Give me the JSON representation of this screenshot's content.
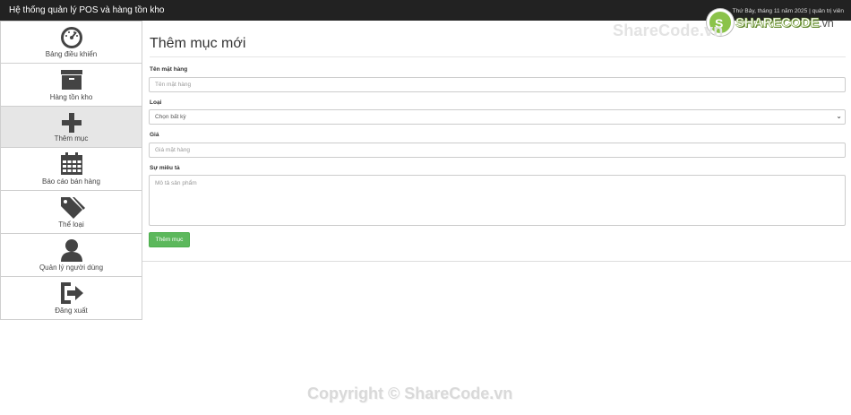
{
  "header": {
    "brand": "Hệ thống quản lý POS và hàng tồn kho",
    "info": "Thứ Bảy, tháng 11 năm 2025 | quản trị viên"
  },
  "logo": {
    "initial": "S",
    "word": "SHARECODE",
    "tld": ".vn"
  },
  "watermarks": {
    "top": "ShareCode.vn",
    "bottom": "Copyright © ShareCode.vn"
  },
  "sidebar": {
    "items": [
      {
        "label": "Bảng điều khiển",
        "icon": "dashboard-icon"
      },
      {
        "label": "Hàng tồn kho",
        "icon": "archive-icon"
      },
      {
        "label": "Thêm mục",
        "icon": "plus-icon",
        "active": true
      },
      {
        "label": "Báo cáo bán hàng",
        "icon": "calendar-icon"
      },
      {
        "label": "Thể loại",
        "icon": "tags-icon"
      },
      {
        "label": "Quản lý người dùng",
        "icon": "user-icon"
      },
      {
        "label": "Đăng xuất",
        "icon": "sign-out-icon"
      }
    ]
  },
  "form": {
    "title": "Thêm mục mới",
    "name_label": "Tên mặt hàng",
    "name_placeholder": "Tên mặt hàng",
    "category_label": "Loại",
    "category_value": "Chọn bất kỳ",
    "price_label": "Giá",
    "price_placeholder": "Giá mặt hàng",
    "description_label": "Sự miêu tả",
    "description_placeholder": "Mô tả sản phẩm",
    "submit_label": "Thêm mục"
  },
  "colors": {
    "topbar": "#222222",
    "submit": "#5cb85c",
    "active_nav": "#e6e6e6",
    "icon": "#444444"
  }
}
